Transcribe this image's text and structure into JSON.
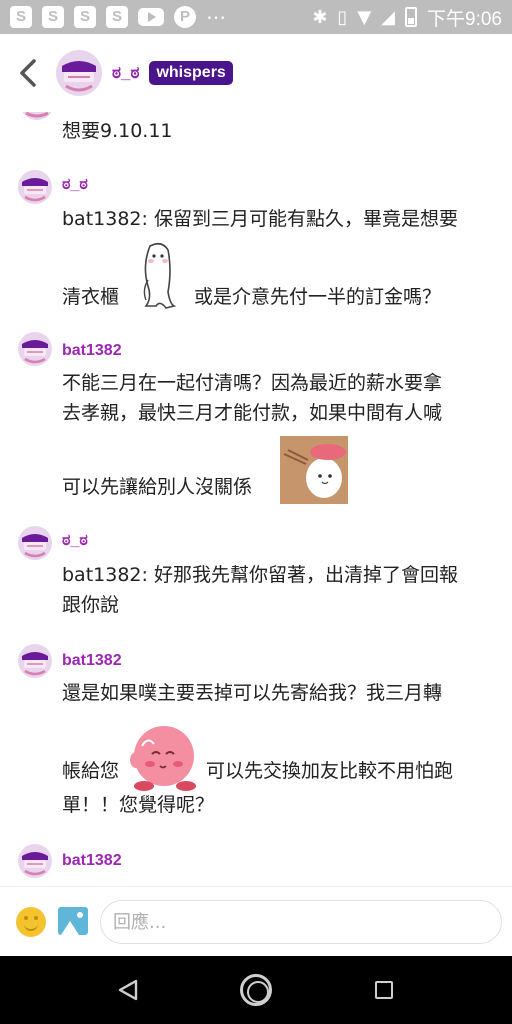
{
  "statusbar": {
    "time": "下午9:06",
    "icons": [
      "shopee-bag-icon",
      "shopee-bag-icon",
      "shopee-bag-icon",
      "shopee-bag-icon",
      "youtube-icon",
      "pinterest-icon",
      "more-dots-icon",
      "bluetooth-icon",
      "vibrate-icon",
      "wifi-icon",
      "signal-icon",
      "battery-icon"
    ],
    "dots": "⋯"
  },
  "header": {
    "name": "ಠ_ಠ",
    "badge": "whispers",
    "back_icon": "chevron-left-icon"
  },
  "messages": [
    {
      "name": "",
      "text": "想要9.10.11"
    },
    {
      "name": "ಠ_ಠ",
      "text_lines": [
        "bat1382: 保留到三月可能有點久，畢竟是想要",
        "清衣櫃",
        "或是介意先付一半的訂金嗎？"
      ]
    },
    {
      "name": "bat1382",
      "text_lines": [
        "不能三月在一起付清嗎？因為最近的薪水要拿",
        "去孝親，最快三月才能付款，如果中間有人喊",
        "可以先讓給別人沒關係"
      ]
    },
    {
      "name": "ಠ_ಠ",
      "text_lines": [
        "bat1382: 好那我先幫你留著，出清掉了會回報",
        "跟你說"
      ]
    },
    {
      "name": "bat1382",
      "text_lines": [
        "還是如果噗主要丟掉可以先寄給我？我三月轉",
        "帳給您",
        "可以先交換加友比較不用怕跑",
        "單！！您覺得呢？"
      ]
    },
    {
      "name": "bat1382"
    }
  ],
  "input": {
    "placeholder": "回應...",
    "emoji_icon": "smiley-icon",
    "image_icon": "image-icon"
  },
  "colors": {
    "accent_purple": "#9c27b0",
    "badge_bg": "#4a148c",
    "statusbar": "#bdbdbd"
  }
}
